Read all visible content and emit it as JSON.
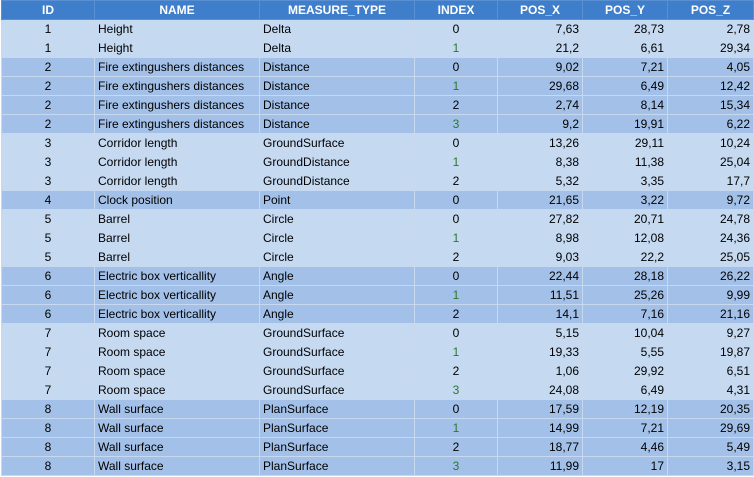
{
  "table": {
    "columns": [
      "ID",
      "NAME",
      "MEASURE_TYPE",
      "INDEX",
      "POS_X",
      "POS_Y",
      "POS_Z"
    ],
    "rows": [
      [
        "1",
        "Height",
        "Delta",
        "0",
        "7,63",
        "28,73",
        "2,78"
      ],
      [
        "1",
        "Height",
        "Delta",
        "1",
        "21,2",
        "6,61",
        "29,34"
      ],
      [
        "2",
        "Fire extingushers distances",
        "Distance",
        "0",
        "9,02",
        "7,21",
        "4,05"
      ],
      [
        "2",
        "Fire extingushers distances",
        "Distance",
        "1",
        "29,68",
        "6,49",
        "12,42"
      ],
      [
        "2",
        "Fire extingushers distances",
        "Distance",
        "2",
        "2,74",
        "8,14",
        "15,34"
      ],
      [
        "2",
        "Fire extingushers distances",
        "Distance",
        "3",
        "9,2",
        "19,91",
        "6,22"
      ],
      [
        "3",
        "Corridor length",
        "GroundSurface",
        "0",
        "13,26",
        "29,11",
        "10,24"
      ],
      [
        "3",
        "Corridor length",
        "GroundDistance",
        "1",
        "8,38",
        "11,38",
        "25,04"
      ],
      [
        "3",
        "Corridor length",
        "GroundDistance",
        "2",
        "5,32",
        "3,35",
        "17,7"
      ],
      [
        "4",
        "Clock position",
        "Point",
        "0",
        "21,65",
        "3,22",
        "9,72"
      ],
      [
        "5",
        "Barrel",
        "Circle",
        "0",
        "27,82",
        "20,71",
        "24,78"
      ],
      [
        "5",
        "Barrel",
        "Circle",
        "1",
        "8,98",
        "12,08",
        "24,36"
      ],
      [
        "5",
        "Barrel",
        "Circle",
        "2",
        "9,03",
        "22,2",
        "25,05"
      ],
      [
        "6",
        "Electric box verticallity",
        "Angle",
        "0",
        "22,44",
        "28,18",
        "26,22"
      ],
      [
        "6",
        "Electric box verticallity",
        "Angle",
        "1",
        "11,51",
        "25,26",
        "9,99"
      ],
      [
        "6",
        "Electric box verticallity",
        "Angle",
        "2",
        "14,1",
        "7,16",
        "21,16"
      ],
      [
        "7",
        "Room space",
        "GroundSurface",
        "0",
        "5,15",
        "10,04",
        "9,27"
      ],
      [
        "7",
        "Room space",
        "GroundSurface",
        "1",
        "19,33",
        "5,55",
        "19,87"
      ],
      [
        "7",
        "Room space",
        "GroundSurface",
        "2",
        "1,06",
        "29,92",
        "6,51"
      ],
      [
        "7",
        "Room space",
        "GroundSurface",
        "3",
        "24,08",
        "6,49",
        "4,31"
      ],
      [
        "8",
        "Wall surface",
        "PlanSurface",
        "0",
        "17,59",
        "12,19",
        "20,35"
      ],
      [
        "8",
        "Wall surface",
        "PlanSurface",
        "1",
        "14,99",
        "7,21",
        "29,69"
      ],
      [
        "8",
        "Wall surface",
        "PlanSurface",
        "2",
        "18,77",
        "4,46",
        "5,49"
      ],
      [
        "8",
        "Wall surface",
        "PlanSurface",
        "3",
        "11,99",
        "17",
        "3,15"
      ]
    ]
  },
  "colors": {
    "header_bg": "#3f7ecb",
    "group_light": "#c5d9f1",
    "group_dark": "#a3c1e8"
  }
}
